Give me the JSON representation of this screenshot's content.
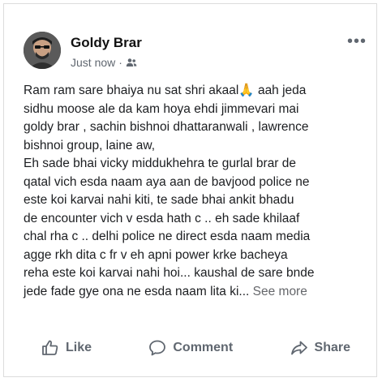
{
  "post": {
    "author_name": "Goldy Brar",
    "timestamp": "Just now",
    "separator": "·",
    "audience_icon": "friends-icon",
    "more_icon": "more-options-icon",
    "text_lines": [
      "Ram ram sare bhaiya nu sat shri akaal🙏 aah jeda",
      "sidhu moose ale da kam hoya ehdi jimmevari mai",
      "goldy brar , sachin bishnoi dhattaranwali , lawrence",
      "bishnoi group,  laine aw,",
      "Eh sade bhai vicky middukhehra te gurlal brar de",
      "qatal vich esda naam aya aan de bavjood police ne",
      "este koi karvai nahi kiti, te sade bhai ankit bhadu",
      "de encounter vich v esda hath c .. eh sade khilaaf",
      "chal rha c .. delhi police ne direct esda naam media",
      "agge rkh dita c fr v eh apni power krke bacheya",
      "reha este koi karvai nahi hoi... kaushal de sare bnde"
    ],
    "last_line": "jede fade gye ona ne esda naam lita ki...",
    "see_more": "See more"
  },
  "actions": {
    "like_label": "Like",
    "comment_label": "Comment",
    "share_label": "Share"
  },
  "colors": {
    "text": "#1c1e21",
    "muted": "#606770"
  }
}
